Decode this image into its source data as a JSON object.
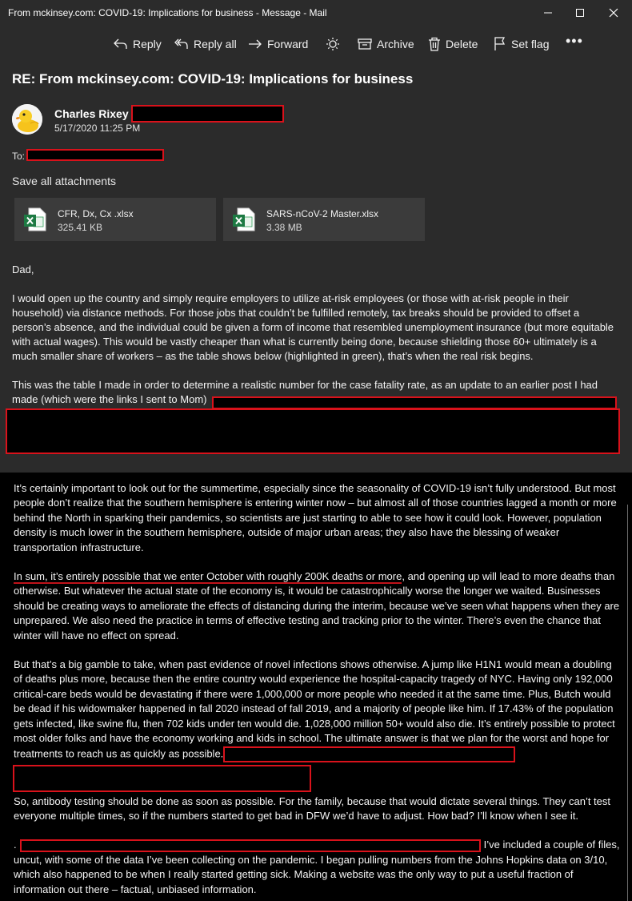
{
  "window": {
    "title": "From mckinsey.com: COVID-19: Implications for business - Message - Mail"
  },
  "toolbar": {
    "reply": "Reply",
    "reply_all": "Reply all",
    "forward": "Forward",
    "archive": "Archive",
    "delete": "Delete",
    "set_flag": "Set flag",
    "more": "•••"
  },
  "message": {
    "subject": "RE: From mckinsey.com: COVID-19: Implications for business",
    "sender": "Charles Rixey",
    "date": "5/17/2020 11:25 PM",
    "to_label": "To:",
    "save_all": "Save all attachments",
    "attachments": [
      {
        "name": "CFR, Dx, Cx .xlsx",
        "size": "325.41 KB"
      },
      {
        "name": "SARS-nCoV-2 Master.xlsx",
        "size": "3.38 MB"
      }
    ],
    "greeting": "Dad,",
    "para1": "I would open up the country and simply require employers to utilize at-risk employees (or those with at-risk people in their household) via distance methods. For those jobs that couldn’t be fulfilled remotely, tax breaks should be provided to offset a person’s absence, and the individual could be given a form of income that resembled unemployment insurance (but more equitable with actual wages). This would be vastly cheaper than what is currently being done, because shielding those 60+ ultimately is a much smaller share of workers – as the table shows below (highlighted in green), that’s when the real risk begins.",
    "para2": "This was the table I made in order to determine a realistic number for the case fatality rate, as an update to an earlier post I had made (which were the links I sent to Mom)"
  },
  "document": {
    "para3": "It’s certainly important to look out for the summertime, especially since the seasonality of COVID-19 isn’t fully understood. But most people don’t realize that the southern hemisphere is entering winter now – but almost all of those countries lagged a month or more behind the North in sparking their pandemics, so scientists are just starting to able to see how it could look. However, population density is much lower in the southern hemisphere, outside of major urban areas; they also have the blessing of weaker transportation infrastructure.",
    "para4_underlined": "In sum, it’s entirely possible that we enter October with roughly 200K deaths or more",
    "para4_rest": ", and opening up will lead to more deaths than otherwise. But whatever the actual state of the economy is, it would be catastrophically worse the longer we waited. Businesses should be creating ways to ameliorate the effects of distancing during the interim, because we’ve seen what happens when they are unprepared. We also need the practice in terms of effective testing and tracking prior to the winter. There’s even the chance that winter will have no effect on spread.",
    "para5": "But that’s a big gamble to take, when past evidence of novel infections shows otherwise. A jump like H1N1 would mean a doubling of deaths plus more, because then the entire country would experience the hospital-capacity tragedy of NYC. Having only 192,000 critical-care beds would be devastating if there were 1,000,000 or more people who needed it at the same time. Plus, Butch would be dead if his widowmaker happened in fall 2020 instead of fall 2019, and a majority of people like him. If 17.43% of the population gets infected, like swine flu, then 702 kids under ten would die. 1,028,000 million 50+ would also die. It’s entirely possible to protect most older folks and have the economy working and kids in school. The ultimate answer is that we plan for the worst and hope for treatments to reach us as quickly as possible.",
    "para6": "So, antibody testing should be done as soon as possible. For the family, because that would dictate several things. They can’t test everyone multiple times, so if the numbers started to get bad in DFW we’d have to adjust. How bad? I’ll know when I see it.",
    "para7_lead": ".",
    "para7": "I’ve included a couple of files, uncut, with some of the data I’ve been collecting on the pandemic. I began pulling numbers from the Johns Hopkins data on 3/10, which also happened to be when I really started getting sick. Making a website was the only way to put a useful fraction of information out there – factual, unbiased information."
  }
}
